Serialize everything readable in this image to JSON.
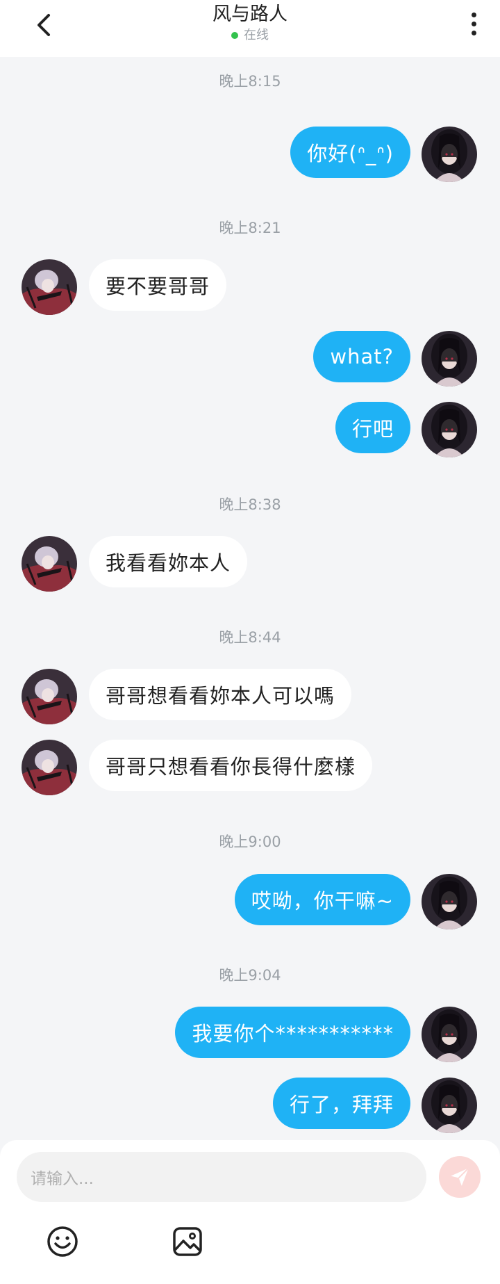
{
  "header": {
    "title": "风与路人",
    "status": "在线",
    "status_color": "#33c24d",
    "back_icon": "chevron-left-icon",
    "menu_icon": "more-vertical-icon"
  },
  "messages": [
    {
      "type": "time",
      "text": "晚上8:15"
    },
    {
      "type": "out",
      "text": "你好(ᐢ_ᐢ)"
    },
    {
      "type": "time",
      "text": "晚上8:21"
    },
    {
      "type": "in",
      "text": "要不要哥哥"
    },
    {
      "type": "out",
      "text": "what?"
    },
    {
      "type": "out",
      "text": "行吧"
    },
    {
      "type": "time",
      "text": "晚上8:38"
    },
    {
      "type": "in",
      "text": "我看看妳本人"
    },
    {
      "type": "time",
      "text": "晚上8:44"
    },
    {
      "type": "in",
      "text": "哥哥想看看妳本人可以嗎"
    },
    {
      "type": "in",
      "text": "哥哥只想看看你長得什麼樣"
    },
    {
      "type": "time",
      "text": "晚上9:00"
    },
    {
      "type": "out",
      "text": "哎呦，你干嘛~"
    },
    {
      "type": "time",
      "text": "晚上9:04"
    },
    {
      "type": "out",
      "text": "我要你个***********"
    },
    {
      "type": "out",
      "text": "行了，拜拜"
    }
  ],
  "input": {
    "placeholder": "请输入...",
    "send_icon": "send-icon"
  },
  "toolbar": {
    "emoji_icon": "smiley-icon",
    "image_icon": "image-icon"
  },
  "colors": {
    "outgoing_bubble": "#1fb2f5",
    "incoming_bubble": "#ffffff",
    "background": "#f4f5f7",
    "send_button": "#fbd9d7"
  }
}
